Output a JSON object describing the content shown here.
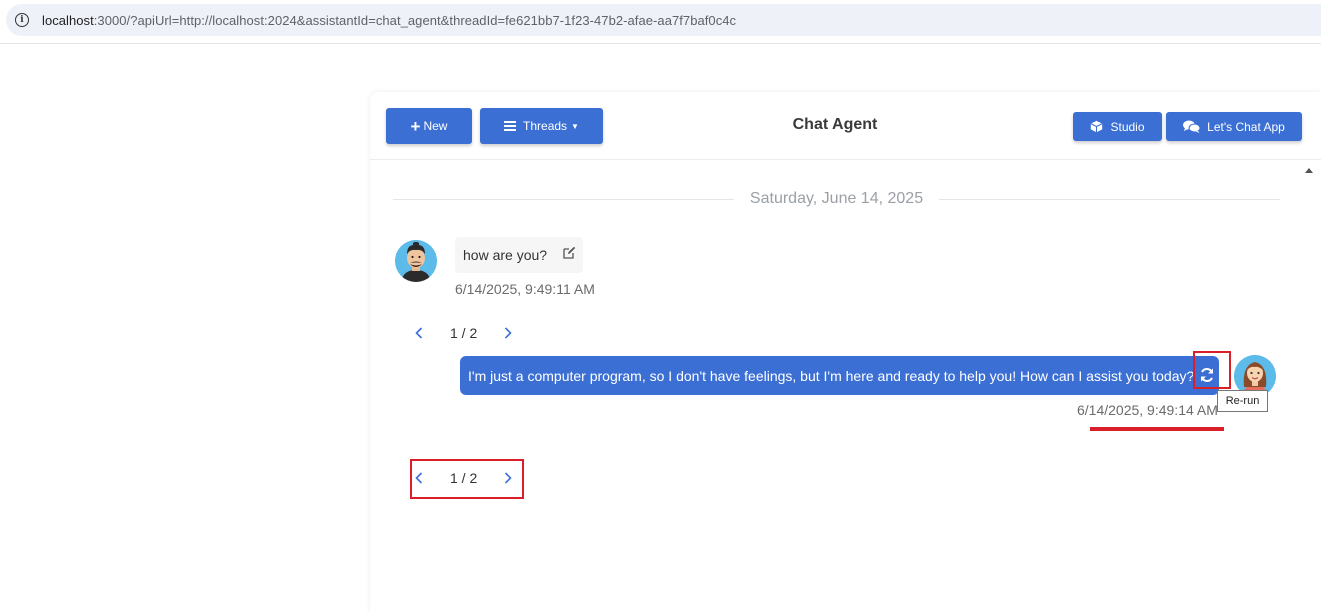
{
  "browser": {
    "url_host": "localhost",
    "url_rest": ":3000/?apiUrl=http://localhost:2024&assistantId=chat_agent&threadId=fe621bb7-1f23-47b2-afae-aa7f7baf0c4c"
  },
  "header": {
    "new_label": "New",
    "threads_label": "Threads",
    "title": "Chat Agent",
    "studio_label": "Studio",
    "letschat_label": "Let's Chat App"
  },
  "conversation": {
    "date": "Saturday, June 14, 2025",
    "user_message": {
      "text": "how are you?",
      "timestamp": "6/14/2025, 9:49:11 AM"
    },
    "pager_top": "1 / 2",
    "bot_message": {
      "text": "I'm just a computer program, so I don't have feelings, but I'm here and ready to help you! How can I assist you today?",
      "timestamp": "6/14/2025, 9:49:14 AM",
      "tooltip": "Re-run"
    },
    "pager_bottom": "1 / 2"
  },
  "colors": {
    "accent": "#3b6fd4",
    "annotation": "#d81f2a"
  }
}
